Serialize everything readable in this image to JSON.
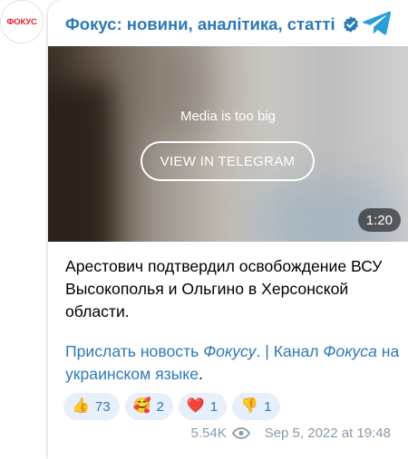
{
  "channel": {
    "avatar_text": "ФОКУС",
    "name": "Фокус: новини, аналітика, статті"
  },
  "media": {
    "notice": "Media is too big",
    "button_label": "VIEW IN TELEGRAM",
    "duration": "1:20"
  },
  "message": {
    "text": "Арестович подтвердил освобождение ВСУ Высокополья и Ольгино в Херсонской области.",
    "links": {
      "part1": "Прислать новость ",
      "part1_em": "Фокусу",
      "part1_end": ".",
      "separator": " | ",
      "part2": "Канал ",
      "part2_em": "Фокуса",
      "part2_end": " на украинском языке",
      "final": "."
    }
  },
  "reactions": [
    {
      "emoji": "👍",
      "count": "73"
    },
    {
      "emoji": "🥰",
      "count": "2"
    },
    {
      "emoji": "❤️",
      "count": "1"
    },
    {
      "emoji": "👎",
      "count": "1"
    }
  ],
  "footer": {
    "views": "5.54K",
    "date": "Sep 5, 2022 at 19:48"
  },
  "colors": {
    "accent": "#2c79b8",
    "brand_red": "#e4202a",
    "reaction_bg": "#e7f0fa",
    "meta_gray": "#8a9aa8"
  }
}
